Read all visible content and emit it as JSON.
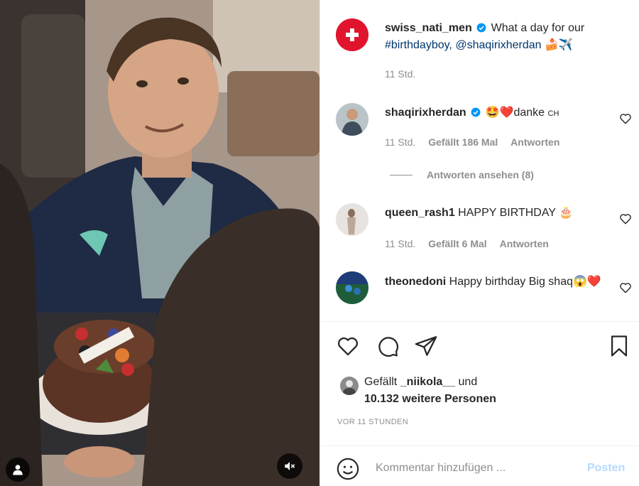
{
  "post": {
    "author": "swiss_nati_men",
    "caption_text": "What a day for our",
    "hashtag": "#birthdayboy,",
    "mention": "@shaqirixherdan",
    "caption_emojis": "🍰✈️",
    "time": "11 Std."
  },
  "comments": [
    {
      "username": "shaqirixherdan",
      "verified": true,
      "text_emojis": "🤩❤️",
      "text": "danke",
      "suffix": "CH",
      "time": "11 Std.",
      "likes": "Gefällt 186 Mal",
      "reply_label": "Antworten"
    },
    {
      "username": "queen_rash1",
      "text": "HAPPY BIRTHDAY",
      "text_emojis": "🎂",
      "time": "11 Std.",
      "likes": "Gefällt 6 Mal",
      "reply_label": "Antworten"
    },
    {
      "username": "theonedoni",
      "text": "Happy birthday Big shaq",
      "text_emojis": "😱❤️"
    }
  ],
  "view_replies": "Antworten ansehen (8)",
  "likes_summary": {
    "line1_prefix": "Gefällt",
    "liker": "_niikola__",
    "line1_suffix": "und",
    "line2": "10.132 weitere Personen"
  },
  "time_ago": "VOR 11 STUNDEN",
  "comment_input": {
    "placeholder": "Kommentar hinzufügen ...",
    "post_label": "Posten"
  },
  "icons": {
    "like": "heart-icon",
    "comment": "comment-icon",
    "share": "paper-plane-icon",
    "save": "bookmark-icon",
    "emoji": "emoji-smiley-icon",
    "user_tag": "user-tag-icon",
    "mute": "speaker-muted-icon",
    "verified": "verified-badge-icon"
  },
  "colors": {
    "swiss_red": "#e1142d",
    "verified_blue": "#0095f6",
    "post_disabled": "#b3dbff",
    "link": "#00376b",
    "muted_text": "#8e8e8e"
  }
}
